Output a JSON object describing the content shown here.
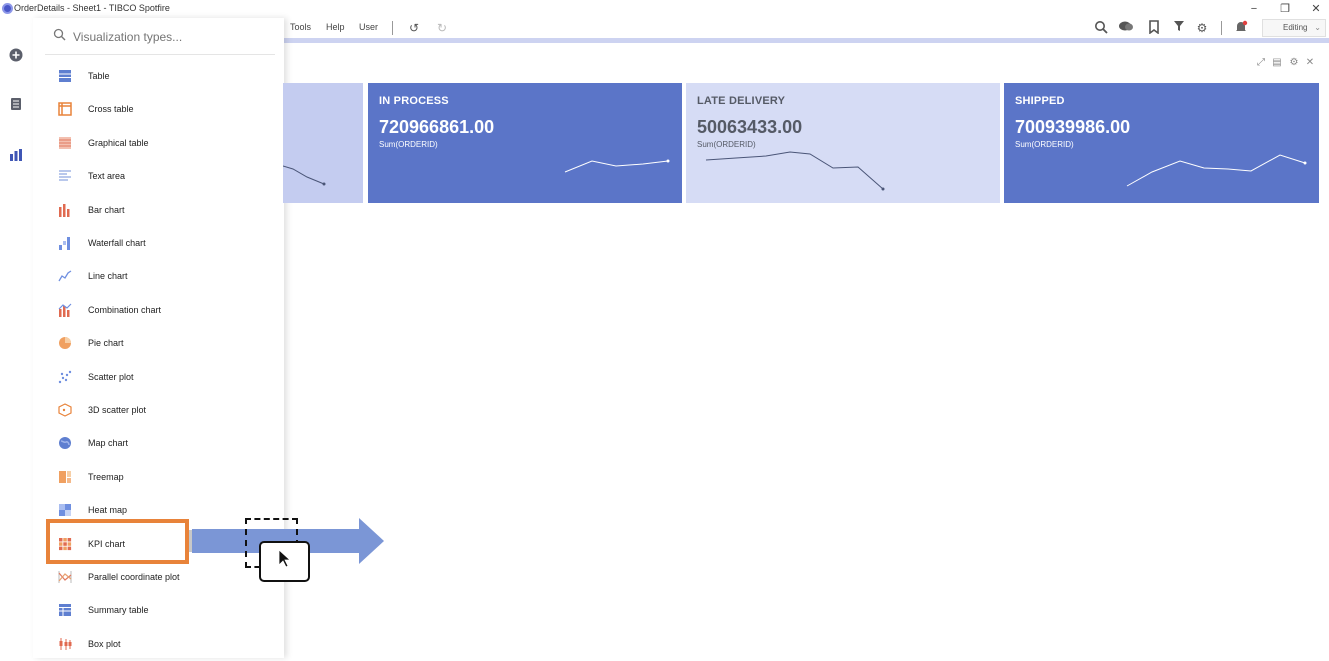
{
  "window": {
    "title": "OrderDetails - Sheet1 - TIBCO Spotfire",
    "controls": {
      "minimize": "−",
      "restore": "❐",
      "close": "✕"
    }
  },
  "menu": {
    "items": [
      "Tools",
      "Help",
      "User"
    ],
    "mode": "Editing"
  },
  "search": {
    "placeholder": "Visualization types..."
  },
  "viz_types": [
    {
      "label": "Table",
      "icon": "table-icon",
      "color": "#5f7fd0"
    },
    {
      "label": "Cross table",
      "icon": "cross-table-icon",
      "color": "#e8833a"
    },
    {
      "label": "Graphical table",
      "icon": "graphical-table-icon",
      "color": "#e07a60"
    },
    {
      "label": "Text area",
      "icon": "text-area-icon",
      "color": "#8fa8e0"
    },
    {
      "label": "Bar chart",
      "icon": "bar-chart-icon",
      "color": "#e06a50"
    },
    {
      "label": "Waterfall chart",
      "icon": "waterfall-chart-icon",
      "color": "#6f8fe0"
    },
    {
      "label": "Line chart",
      "icon": "line-chart-icon",
      "color": "#6f8fe0"
    },
    {
      "label": "Combination chart",
      "icon": "combination-chart-icon",
      "color": "#e06a50"
    },
    {
      "label": "Pie chart",
      "icon": "pie-chart-icon",
      "color": "#f0a060"
    },
    {
      "label": "Scatter plot",
      "icon": "scatter-plot-icon",
      "color": "#6f8fe0"
    },
    {
      "label": "3D scatter plot",
      "icon": "3d-scatter-plot-icon",
      "color": "#e8833a"
    },
    {
      "label": "Map chart",
      "icon": "map-chart-icon",
      "color": "#5f7fd0"
    },
    {
      "label": "Treemap",
      "icon": "treemap-icon",
      "color": "#f0a060"
    },
    {
      "label": "Heat map",
      "icon": "heat-map-icon",
      "color": "#6f8fe0"
    },
    {
      "label": "KPI chart",
      "icon": "kpi-chart-icon",
      "color": "#e06a50"
    },
    {
      "label": "Parallel coordinate plot",
      "icon": "parallel-coordinate-plot-icon",
      "color": "#e07a60"
    },
    {
      "label": "Summary table",
      "icon": "summary-table-icon",
      "color": "#5f7fd0"
    },
    {
      "label": "Box plot",
      "icon": "box-plot-icon",
      "color": "#e06a50"
    }
  ],
  "kpi_tiles": [
    {
      "title": "",
      "value": "",
      "measure": "",
      "bg": "#c4ccf0",
      "fg": "#ffffff"
    },
    {
      "title": "IN PROCESS",
      "value": "720966861.00",
      "measure": "Sum(ORDERID)",
      "bg": "#5b75c8",
      "fg": "#ffffff"
    },
    {
      "title": "LATE DELIVERY",
      "value": "50063433.00",
      "measure": "Sum(ORDERID)",
      "bg": "#d6dcf5",
      "fg": "#555a66"
    },
    {
      "title": "SHIPPED",
      "value": "700939986.00",
      "measure": "Sum(ORDERID)",
      "bg": "#5b75c8",
      "fg": "#ffffff"
    }
  ],
  "colors": {
    "accent": "#cdd3f1",
    "highlight": "#e8833a",
    "arrow": "#7b96d6"
  }
}
